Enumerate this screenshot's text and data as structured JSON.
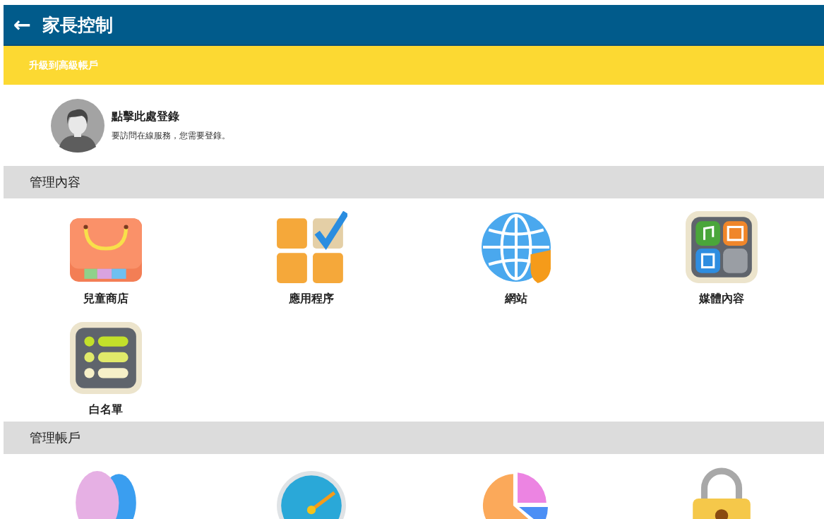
{
  "app_bar": {
    "back": "←",
    "title": "家長控制"
  },
  "upgrade_banner": {
    "text": "升級到高級帳戶"
  },
  "login": {
    "title": "點擊此處登錄",
    "subtitle": "要訪問在線服務，您需要登錄。"
  },
  "sections": [
    {
      "title": "管理內容",
      "items": [
        {
          "kind": "store",
          "label": "兒童商店"
        },
        {
          "kind": "apps",
          "label": "應用程序"
        },
        {
          "kind": "web",
          "label": "網站"
        },
        {
          "kind": "media",
          "label": "媒體內容"
        },
        {
          "kind": "list",
          "label": "白名單"
        }
      ]
    },
    {
      "title": "管理帳戶",
      "items": [
        {
          "kind": "people"
        },
        {
          "kind": "gauge"
        },
        {
          "kind": "pie"
        },
        {
          "kind": "lock"
        }
      ]
    }
  ]
}
